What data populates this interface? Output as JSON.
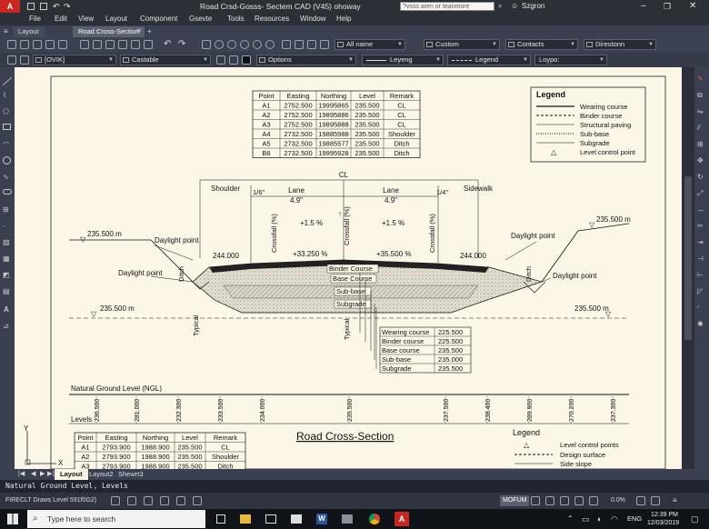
{
  "title_bar": {
    "title": "Road Crsd-Gosss- Sectem CAD (V45) ohoway",
    "search_placeholder": "?vsss aren or teanmore",
    "user": "Szgron"
  },
  "menu": [
    "File",
    "Edit",
    "View",
    "Layout",
    "Component",
    "Gsevte",
    "Tools",
    "Resources",
    "Window",
    "Help"
  ],
  "doc_tabs": [
    "Layout",
    "Road Cross-Section"
  ],
  "toolbar1": {
    "layer": "All name",
    "style": "Custom",
    "contacts": "Contacts",
    "direction": "Direstonn"
  },
  "toolbar2": {
    "ovik": "[OVIK]",
    "castable": "Castable",
    "options": "Options",
    "leyeng": "Leyeng",
    "legend": "Legend",
    "loypo": "Loypo:"
  },
  "drawing": {
    "table1": {
      "headers": [
        "Point",
        "Easting",
        "Northing",
        "Level",
        "Remark"
      ],
      "rows": [
        [
          "A1",
          "2752.500",
          "19995865",
          "235.500",
          "CL"
        ],
        [
          "A2",
          "2752.500",
          "19895886",
          "235.500",
          "CL"
        ],
        [
          "A3",
          "2752.500",
          "19895888",
          "235.500",
          "CL"
        ],
        [
          "A4",
          "2732.500",
          "19885988",
          "235.500",
          "Shoulder"
        ],
        [
          "A5",
          "2732.500",
          "19885577",
          "235.500",
          "Ditch"
        ],
        [
          "B6",
          "2732.500",
          "19995928",
          "235.500",
          "Ditch"
        ]
      ]
    },
    "legend1": {
      "title": "Legend",
      "items": [
        "Wearing course",
        "Binder course",
        "Structural paving",
        "Sub-base",
        "Subgrade",
        "Level control point"
      ]
    },
    "labels": {
      "cl": "CL",
      "shoulder": "Shoulder",
      "sidewalk": "Sidewalk",
      "lane_left": "Lane",
      "lane_right": "Lane",
      "lane_left_w": "4.9\"",
      "lane_right_w": "4.9\"",
      "slope_left_top": "1/6\"",
      "slope_right_top": "1/4\"",
      "cross1": "Crossfall (%)",
      "cross2": "Crossfall (%)",
      "cross3": "Crossfall (%)",
      "pct_left": "+1.5 %",
      "pct_right": "+1.5 %",
      "pct_mid_left": "+33.250 %",
      "pct_mid_right": "+35.500 %",
      "lvl_tl": "235.500 m",
      "lvl_tr": "235.500 m",
      "lvl_ml": "235.500 m",
      "lvl_mr": "235.500 m",
      "lvl_244_l": "244.000",
      "lvl_244_r": "244.000",
      "daylight_1": "Daylight point",
      "daylight_2": "Daylight point",
      "daylight_3": "Daylight point",
      "daylight_4": "Daylight point",
      "ditch_l": "Ditch",
      "ditch_r": "Ditch",
      "typical_1": "Typical",
      "typical_2": "Typical",
      "binder": "Binder Course",
      "base": "Base Course",
      "subbase": "Sub-base",
      "subgrade": "Subgrade",
      "ngl": "Natural Ground Level (NGL)",
      "levels": "Levels",
      "section_title": "Road Cross-Section"
    },
    "layer_table": [
      [
        "Wearing course",
        "225.500"
      ],
      [
        "Binder course",
        "225.500"
      ],
      [
        "Base course",
        "235.500"
      ],
      [
        "Sub-base",
        "235.000"
      ],
      [
        "Subgrade",
        "235.500"
      ]
    ],
    "level_ticks": [
      "236.500",
      "281.000",
      "232.300",
      "233.500",
      "234.000",
      "235.500",
      "237.500",
      "238.400",
      "289.900",
      "270.200",
      "237.300"
    ],
    "table2": {
      "headers": [
        "Point",
        "Easting",
        "Northing",
        "Level",
        "Remark"
      ],
      "rows": [
        [
          "A1",
          "2793.900",
          "1988.900",
          "235.500",
          "CL"
        ],
        [
          "A2",
          "2793.900",
          "1988.900",
          "235.500",
          "Shoulder"
        ],
        [
          "A3",
          "2793.900",
          "1988.900",
          "235.500",
          "Ditch"
        ]
      ]
    },
    "legend2": {
      "title": "Legend",
      "items": [
        "Level control points",
        "Design surface",
        "Side slope"
      ]
    },
    "ucs": {
      "x": "X",
      "y": "Y"
    }
  },
  "layout_tabs": [
    "Layout",
    "Layout2",
    "Shewrt3"
  ],
  "command_line": "Natural Ground Level, Levels",
  "status": {
    "left": "FIRECLT Draws Level 591f0G2)",
    "mode": "MOFUM",
    "zoom": "0.0%"
  },
  "taskbar": {
    "search_placeholder": "Type here to search",
    "lang": "ENG",
    "time": "12:39 PM",
    "date": "12/03/2019"
  }
}
